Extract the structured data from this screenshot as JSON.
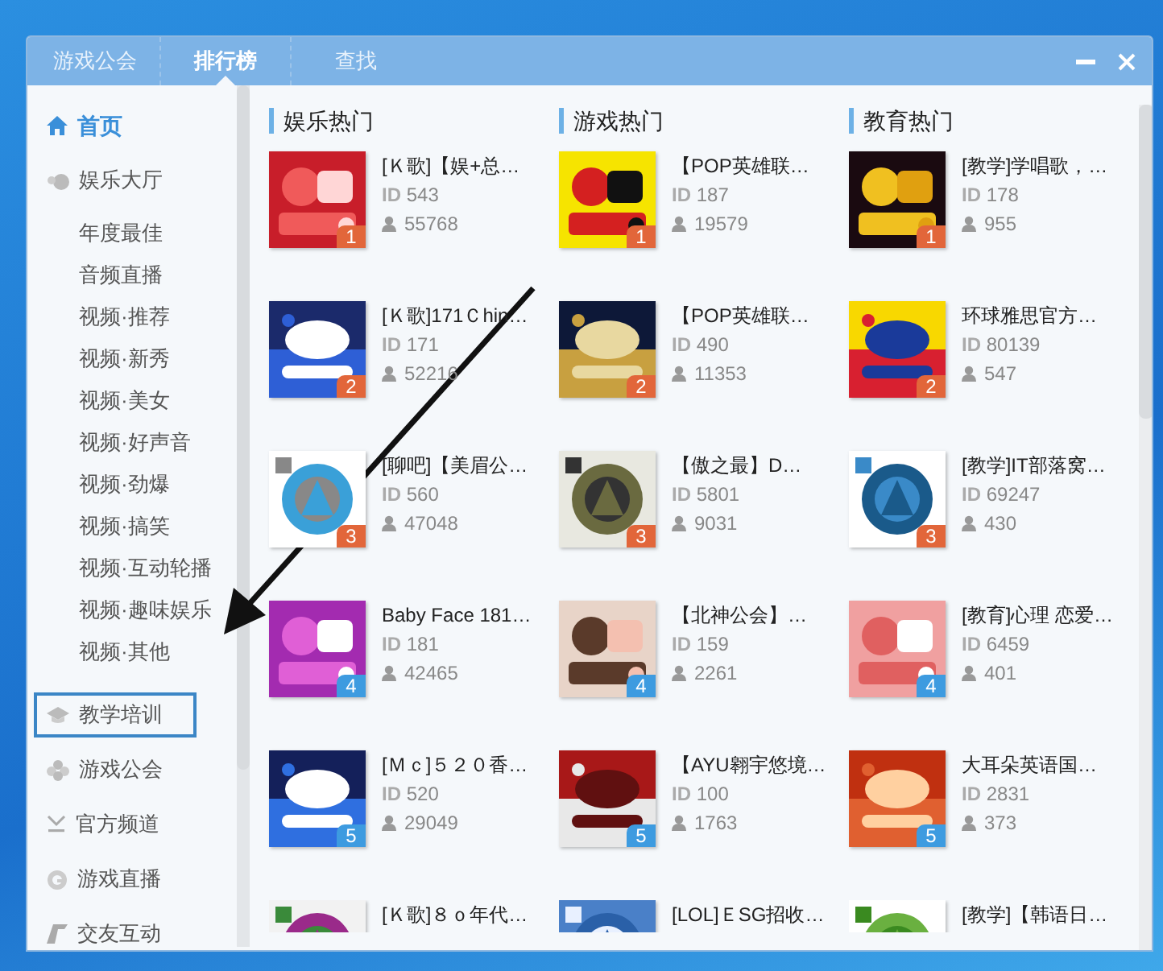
{
  "tabs": [
    {
      "label": "游戏公会",
      "selected": false
    },
    {
      "label": "排行榜",
      "selected": true
    },
    {
      "label": "查找",
      "selected": false
    }
  ],
  "sidebar": {
    "items": [
      {
        "label": "首页",
        "selected": true,
        "outlined": false
      },
      {
        "label": "娱乐大厅",
        "selected": false,
        "outlined": false,
        "children": [
          {
            "label": "年度最佳"
          },
          {
            "label": "音频直播"
          },
          {
            "label": "视频·推荐"
          },
          {
            "label": "视频·新秀"
          },
          {
            "label": "视频·美女"
          },
          {
            "label": "视频·好声音"
          },
          {
            "label": "视频·劲爆"
          },
          {
            "label": "视频·搞笑"
          },
          {
            "label": "视频·互动轮播"
          },
          {
            "label": "视频·趣味娱乐"
          },
          {
            "label": "视频·其他"
          }
        ]
      },
      {
        "label": "教学培训",
        "selected": false,
        "outlined": true
      },
      {
        "label": "游戏公会",
        "selected": false,
        "outlined": false
      },
      {
        "label": "官方频道",
        "selected": false,
        "outlined": false
      },
      {
        "label": "游戏直播",
        "selected": false,
        "outlined": false
      },
      {
        "label": "交友互动",
        "selected": false,
        "outlined": false
      }
    ]
  },
  "columns": [
    {
      "title": "娱乐热门",
      "rooms": [
        {
          "name": "[Ｋ歌]【娱+总…",
          "id_label": "ID",
          "id": "543",
          "users": "55768",
          "rank": "1",
          "color": "#e2663a"
        },
        {
          "name": "[Ｋ歌]171Ｃhin…",
          "id_label": "ID",
          "id": "171",
          "users": "52216",
          "rank": "2",
          "color": "#e2663a"
        },
        {
          "name": "[聊吧]【美眉公…",
          "id_label": "ID",
          "id": "560",
          "users": "47048",
          "rank": "3",
          "color": "#e2663a"
        },
        {
          "name": "Baby Face 181…",
          "id_label": "ID",
          "id": "181",
          "users": "42465",
          "rank": "4",
          "color": "#3d9be0"
        },
        {
          "name": "[Ｍｃ]５２０香…",
          "id_label": "ID",
          "id": "520",
          "users": "29049",
          "rank": "5",
          "color": "#3d9be0"
        },
        {
          "name": "[Ｋ歌]８ｏ年代…"
        }
      ]
    },
    {
      "title": "游戏热门",
      "rooms": [
        {
          "name": "【POP英雄联…",
          "id_label": "ID",
          "id": "187",
          "users": "19579",
          "rank": "1",
          "color": "#e2663a"
        },
        {
          "name": "【POP英雄联…",
          "id_label": "ID",
          "id": "490",
          "users": "11353",
          "rank": "2",
          "color": "#e2663a"
        },
        {
          "name": "【傲之最】D…",
          "id_label": "ID",
          "id": "5801",
          "users": "9031",
          "rank": "3",
          "color": "#e2663a"
        },
        {
          "name": "【北神公会】…",
          "id_label": "ID",
          "id": "159",
          "users": "2261",
          "rank": "4",
          "color": "#3d9be0"
        },
        {
          "name": "【AYU翱宇悠境…",
          "id_label": "ID",
          "id": "100",
          "users": "1763",
          "rank": "5",
          "color": "#3d9be0"
        },
        {
          "name": "[LOL]ＥSG招收…"
        }
      ]
    },
    {
      "title": "教育热门",
      "rooms": [
        {
          "name": "[教学]学唱歌，…",
          "id_label": "ID",
          "id": "178",
          "users": "955",
          "rank": "1",
          "color": "#e2663a"
        },
        {
          "name": "环球雅思官方…",
          "id_label": "ID",
          "id": "80139",
          "users": "547",
          "rank": "2",
          "color": "#e2663a"
        },
        {
          "name": "[教学]IT部落窝…",
          "id_label": "ID",
          "id": "69247",
          "users": "430",
          "rank": "3",
          "color": "#e2663a"
        },
        {
          "name": "[教育]心理 恋爱…",
          "id_label": "ID",
          "id": "6459",
          "users": "401",
          "rank": "4",
          "color": "#3d9be0"
        },
        {
          "name": "大耳朵英语国…",
          "id_label": "ID",
          "id": "2831",
          "users": "373",
          "rank": "5",
          "color": "#3d9be0"
        },
        {
          "name": "[教学]【韩语日…"
        }
      ]
    }
  ]
}
